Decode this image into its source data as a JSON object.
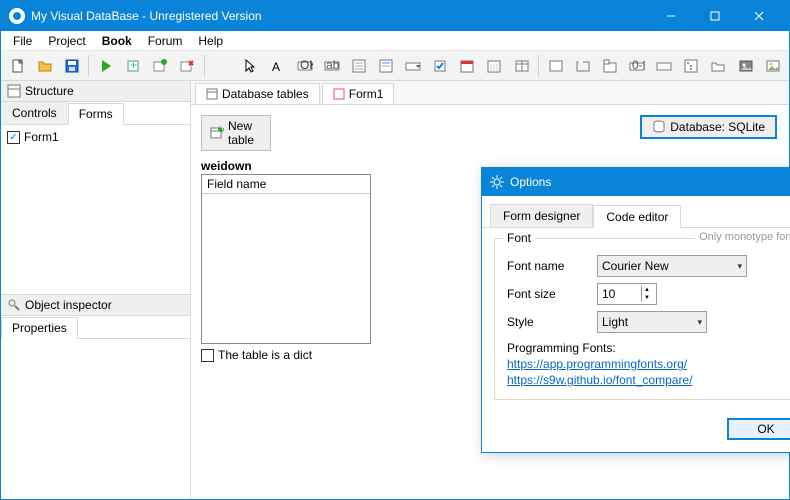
{
  "window": {
    "title": "My Visual DataBase - Unregistered Version"
  },
  "menu": {
    "items": [
      "File",
      "Project",
      "Book",
      "Forum",
      "Help"
    ],
    "bold_index": 2
  },
  "left": {
    "structure": "Structure",
    "tabs": {
      "controls": "Controls",
      "forms": "Forms"
    },
    "items": [
      {
        "label": "Form1",
        "checked": true
      }
    ],
    "inspector": "Object inspector",
    "properties": "Properties"
  },
  "doc_tabs": {
    "db": "Database tables",
    "form": "Form1"
  },
  "actions": {
    "new_table": "New table"
  },
  "db_status": {
    "label": "Database: SQLite"
  },
  "table": {
    "name": "weidown",
    "header": "Field name",
    "dict": "The table is a dict"
  },
  "dialog": {
    "title": "Options",
    "tabs": {
      "designer": "Form designer",
      "editor": "Code editor"
    },
    "group": "Font",
    "hint": "Only monotype fonts",
    "rows": {
      "font_name": {
        "label": "Font name",
        "value": "Courier New"
      },
      "font_size": {
        "label": "Font size",
        "value": "10"
      },
      "style": {
        "label": "Style",
        "value": "Light"
      }
    },
    "links": {
      "heading": "Programming Fonts:",
      "l1": "https://app.programmingfonts.org/",
      "l2": "https://s9w.github.io/font_compare/"
    },
    "ok": "OK"
  }
}
